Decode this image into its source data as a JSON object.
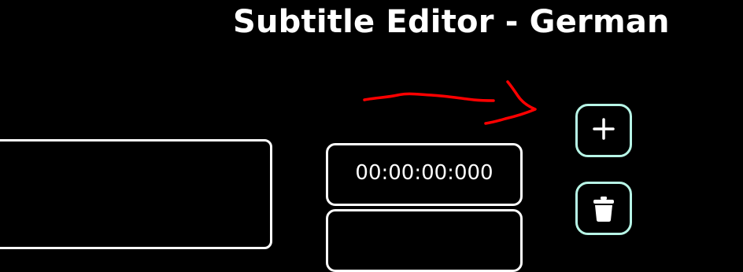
{
  "header": {
    "title": "Subtitle Editor - German"
  },
  "entry": {
    "start_time": "00:00:00:000",
    "end_time": ""
  },
  "actions": {
    "add_icon": "plus-icon",
    "delete_icon": "trash-icon"
  },
  "colors": {
    "background": "#000000",
    "text": "#ffffff",
    "button_border": "#b7f5e6",
    "annotation": "#ff0000"
  }
}
